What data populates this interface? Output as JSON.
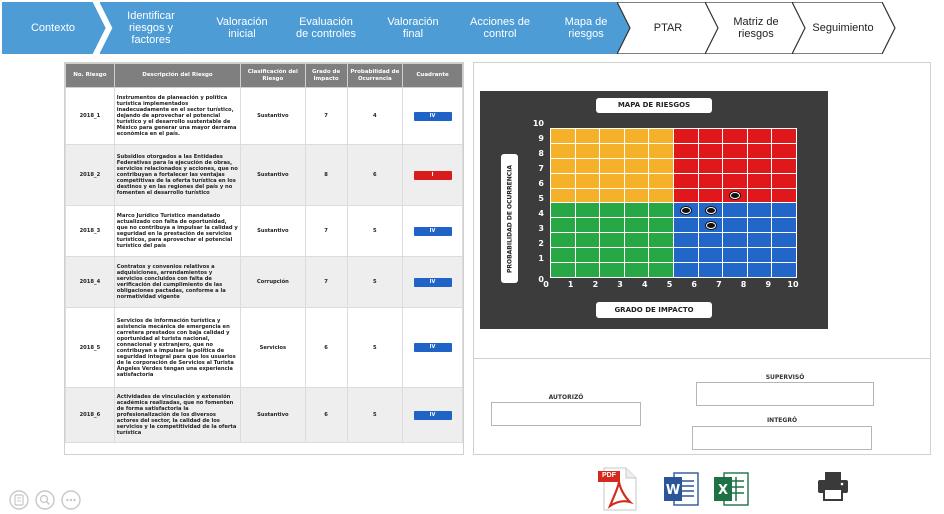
{
  "nav": {
    "steps": [
      {
        "label": "Contexto",
        "state": "active"
      },
      {
        "label": "Identificar riesgos y factores",
        "state": "active"
      },
      {
        "label": "Valoración inicial",
        "state": "active"
      },
      {
        "label": "Evaluación de controles",
        "state": "active"
      },
      {
        "label": "Valoración final",
        "state": "active"
      },
      {
        "label": "Acciones de control",
        "state": "active"
      },
      {
        "label": "Mapa de riesgos",
        "state": "active"
      },
      {
        "label": "PTAR",
        "state": "inactive"
      },
      {
        "label": "Matriz de riesgos",
        "state": "inactive"
      },
      {
        "label": "Seguimiento",
        "state": "inactive"
      }
    ],
    "colors": {
      "active": "#4e9cd6",
      "inactive_fill": "#ffffff",
      "inactive_border": "#333333"
    }
  },
  "table": {
    "headers": {
      "id": "No. Riesgo",
      "desc": "Descripción del Riesgo",
      "class": "Clasificación del Riesgo",
      "impact": "Grado de Impacto",
      "prob": "Probabilidad de Ocurrencia",
      "quad": "Cuadrante"
    },
    "rows": [
      {
        "id": "2018_1",
        "desc": "Instrumentos de planeación y política turística implementados inadecuadamente en el sector turístico, dejando de aprovechar el potencial turístico y el desarrollo sustentable de México para generar una mayor derrama económica en el país.",
        "class": "Sustantivo",
        "impact": "7",
        "prob": "4",
        "quad": "IV",
        "quad_color": "#1f63c6"
      },
      {
        "id": "2018_2",
        "desc": "Subsidios otorgados a las Entidades Federativas para la ejecución de obras, servicios relacionados y acciones, que no contribuyan a fortalecer las ventajas competitivas de la oferta turística en los destinos y en las regiones del país y no fomenten el desarrollo turístico",
        "class": "Sustantivo",
        "impact": "8",
        "prob": "6",
        "quad": "I",
        "quad_color": "#d81c1c"
      },
      {
        "id": "2018_3",
        "desc": "Marco Jurídico Turístico mandatado actualizado con falta de oportunidad, que no contribuya a impulsar la calidad y seguridad en la prestación de servicios turísticos, para aprovechar el potencial turístico del país",
        "class": "Sustantivo",
        "impact": "7",
        "prob": "5",
        "quad": "IV",
        "quad_color": "#1f63c6"
      },
      {
        "id": "2018_4",
        "desc": "Contratos y convenios relativos a adquisiciones, arrendamientos y servicios concluidos con falta de verificación del cumplimiento de las obligaciones pactadas, conforme a la normatividad vigente",
        "class": "Corrupción",
        "impact": "7",
        "prob": "5",
        "quad": "IV",
        "quad_color": "#1f63c6"
      },
      {
        "id": "2018_5",
        "desc": "Servicios de información turística y asistencia mecánica de emergencia en carretera prestados con baja calidad y oportunidad al turista nacional, connacional y extranjero, que no contribuyan a impulsar la política de seguridad integral para que los usuarios de la corporación de Servicios al Turista Ángeles Verdes tengan una experiencia satisfactoria",
        "class": "Servicios",
        "impact": "6",
        "prob": "5",
        "quad": "IV",
        "quad_color": "#1f63c6"
      },
      {
        "id": "2018_6",
        "desc": "Actividades de vinculación y extensión académica realizadas, que no fomenten de forma satisfactoria la profesionalización de los diversos actores del sector, la calidad de los servicios y la competitividad de la oferta turística",
        "class": "Sustantivo",
        "impact": "6",
        "prob": "5",
        "quad": "IV",
        "quad_color": "#1f63c6"
      }
    ]
  },
  "map": {
    "title": "MAPA DE RIESGOS",
    "ylabel": "PROBABILIDAD DE OCURRENCIA",
    "xlabel": "GRADO DE IMPACTO",
    "y_ticks": [
      "10",
      "9",
      "8",
      "7",
      "6",
      "5",
      "4",
      "3",
      "2",
      "1",
      "0"
    ],
    "x_ticks": [
      "0",
      "1",
      "2",
      "3",
      "4",
      "5",
      "6",
      "7",
      "8",
      "9",
      "10"
    ],
    "quadrant_colors": {
      "I": "#e0181b",
      "II": "#f6b12a",
      "III": "#27a844",
      "IV": "#2266c7"
    },
    "points": [
      {
        "impact": 8,
        "prob": 6
      },
      {
        "impact": 6,
        "prob": 5
      },
      {
        "impact": 7,
        "prob": 5
      },
      {
        "impact": 7,
        "prob": 4
      }
    ]
  },
  "signatures": {
    "autorizo": "AUTORIZÓ",
    "superviso": "SUPERVISÓ",
    "integro": "INTEGRÓ"
  },
  "toolbar": {
    "pdf_label": "PDF"
  }
}
